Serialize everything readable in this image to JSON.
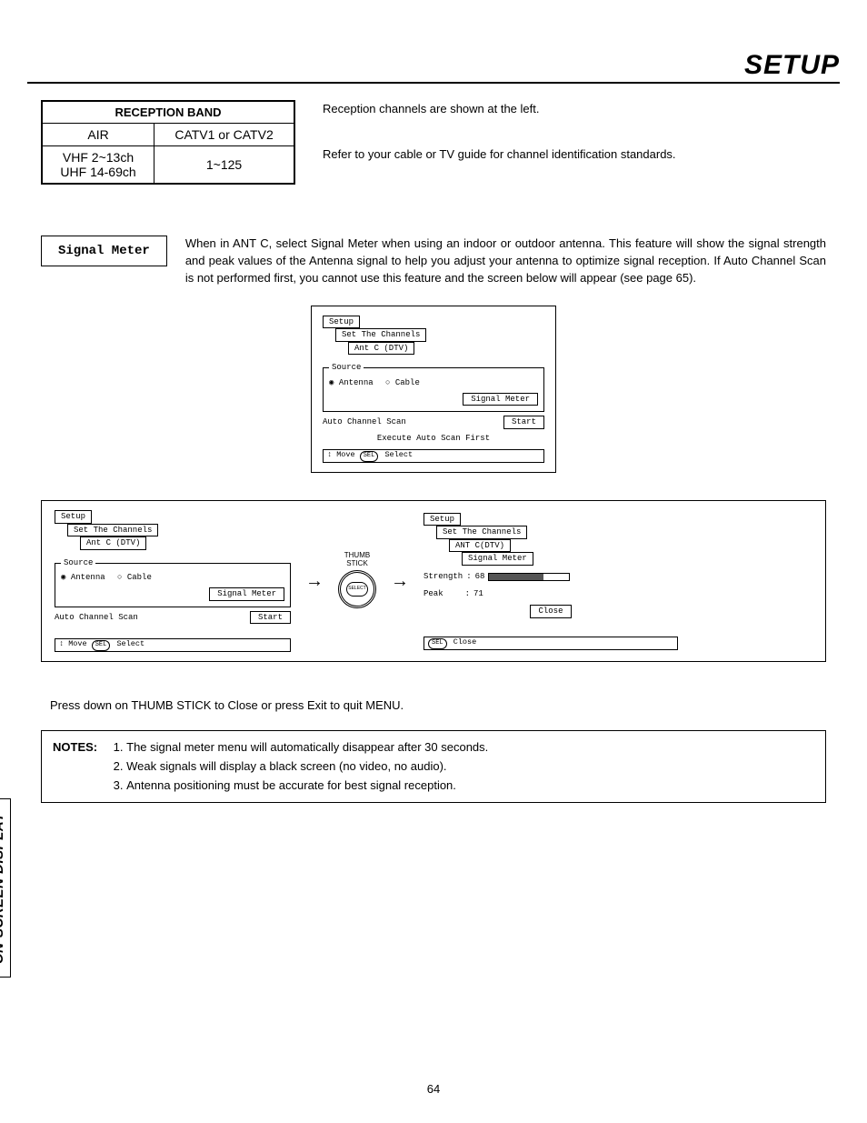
{
  "page_title": "SETUP",
  "side_tab": "ON-SCREEN DISPLAY",
  "page_number": "64",
  "reception_table": {
    "header": "RECEPTION BAND",
    "row1": {
      "c1": "AIR",
      "c2": "CATV1 or CATV2"
    },
    "row2": {
      "c1a": "VHF 2~13ch",
      "c1b": "UHF 14-69ch",
      "c2": "1~125"
    }
  },
  "intro": {
    "l1": "Reception channels are shown at the left.",
    "l2": "Refer to your cable or TV guide for channel identification standards."
  },
  "signal_label": "Signal Meter",
  "signal_para": "When in ANT C, select Signal Meter when using an indoor or outdoor antenna.  This feature will show the signal strength and peak values of the Antenna signal to help you adjust your antenna to optimize signal reception.  If Auto Channel Scan is not performed first, you cannot use this feature and the screen below will appear (see page 65).",
  "osd_a": {
    "t1": "Setup",
    "t2": "Set The Channels",
    "t3": "Ant C (DTV)",
    "src": "Source",
    "antenna": "Antenna",
    "cable": "Cable",
    "signal_btn": "Signal Meter",
    "acs": "Auto Channel Scan",
    "start": "Start",
    "exec": "Execute Auto Scan First",
    "footer_move": "Move",
    "footer_sel": "Select"
  },
  "osd_b": {
    "t1": "Setup",
    "t2": "Set The Channels",
    "t3": "Ant C (DTV)",
    "src": "Source",
    "antenna": "Antenna",
    "cable": "Cable",
    "signal_btn": "Signal Meter",
    "acs": "Auto Channel Scan",
    "start": "Start",
    "footer_move": "Move",
    "footer_sel": "Select"
  },
  "thumb": {
    "l1": "THUMB",
    "l2": "STICK",
    "btn": "SELECT"
  },
  "osd_c": {
    "t1": "Setup",
    "t2": "Set The Channels",
    "t3": "ANT C(DTV)",
    "t4": "Signal Meter",
    "strength_label": "Strength",
    "strength_val": "68",
    "peak_label": "Peak",
    "peak_val": "71",
    "close": "Close",
    "footer_close": "Close"
  },
  "press_line": "Press down on THUMB STICK to Close or press Exit to quit MENU.",
  "notes": {
    "label": "NOTES:",
    "items": [
      "The signal meter menu will automatically disappear after 30 seconds.",
      "Weak signals will display a black screen (no video, no audio).",
      "Antenna positioning must be accurate for best signal reception."
    ]
  }
}
